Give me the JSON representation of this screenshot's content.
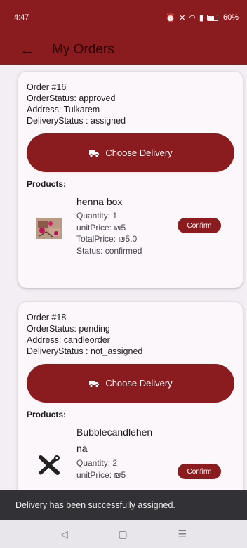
{
  "status_bar": {
    "time": "4:47",
    "battery": "60%"
  },
  "app_bar": {
    "title": "My Orders"
  },
  "orders": [
    {
      "title": "Order #16",
      "order_status": "OrderStatus: approved",
      "address": "Address: Tulkarem",
      "delivery_status": "DeliveryStatus : assigned",
      "button_label": "Choose Delivery",
      "products_label": "Products:",
      "product": {
        "name": "henna box",
        "name_line2": "",
        "quantity": "Quantity: 1",
        "unit_price": "unitPrice: ₪5",
        "total_price": "TotalPrice: ₪5.0",
        "status": "Status: confirmed",
        "confirm_label": "Confirm",
        "image": "henna-box-photo"
      }
    },
    {
      "title": "Order #18",
      "order_status": "OrderStatus: pending",
      "address": "Address: candleorder",
      "delivery_status": "DeliveryStatus : not_assigned",
      "button_label": "Choose Delivery",
      "products_label": "Products:",
      "product": {
        "name": "Bubblecandlehen",
        "name_line2": "na",
        "quantity": "Quantity: 2",
        "unit_price": "unitPrice: ₪5",
        "confirm_label": "Confirm",
        "image": "tools-icon"
      }
    }
  ],
  "snackbar": {
    "message": "Delivery has been successfully assigned."
  },
  "colors": {
    "primary": "#8a1c1f",
    "background": "#f3eef3",
    "card": "#fbf7fb",
    "snackbar": "#323236"
  }
}
